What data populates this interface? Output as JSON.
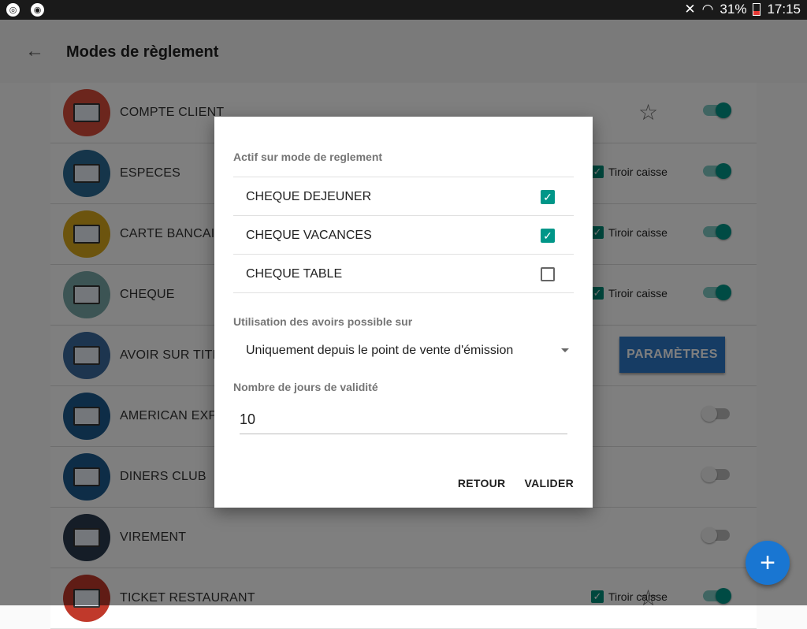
{
  "statusbar": {
    "battery": "31%",
    "time": "17:15"
  },
  "header": {
    "title": "Modes de règlement"
  },
  "payment_modes": [
    {
      "name": "COMPTE CLIENT",
      "avatar_color": "#d84c3b",
      "star": true,
      "drawer": false,
      "switch_on": true,
      "parameters_button": false
    },
    {
      "name": "ESPECES",
      "avatar_color": "#2a6a94",
      "star": false,
      "drawer": true,
      "switch_on": true,
      "parameters_button": false
    },
    {
      "name": "CARTE BANCAIRE",
      "avatar_color": "#d9a91c",
      "star": false,
      "drawer": true,
      "switch_on": true,
      "parameters_button": false
    },
    {
      "name": "CHEQUE",
      "avatar_color": "#79a9a9",
      "star": false,
      "drawer": true,
      "switch_on": true,
      "parameters_button": false
    },
    {
      "name": "AVOIR SUR TITRE",
      "avatar_color": "#3b6b9e",
      "star": false,
      "drawer": false,
      "switch_on": null,
      "parameters_button": true
    },
    {
      "name": "AMERICAN EXPRESS",
      "avatar_color": "#1d5b8f",
      "star": false,
      "drawer": false,
      "switch_on": false,
      "parameters_button": false
    },
    {
      "name": "DINERS CLUB",
      "avatar_color": "#1d5b8f",
      "star": false,
      "drawer": false,
      "switch_on": false,
      "parameters_button": false
    },
    {
      "name": "VIREMENT",
      "avatar_color": "#2b3a4f",
      "star": false,
      "drawer": false,
      "switch_on": false,
      "parameters_button": false
    },
    {
      "name": "TICKET RESTAURANT",
      "avatar_color": "#c0392b",
      "star": true,
      "drawer": true,
      "switch_on": true,
      "parameters_button": false
    }
  ],
  "row_labels": {
    "drawer": "Tiroir caisse",
    "parameters": "PARAMÈTRES"
  },
  "dialog": {
    "section_active": "Actif sur mode de reglement",
    "options": [
      {
        "label": "CHEQUE DEJEUNER",
        "checked": true
      },
      {
        "label": "CHEQUE VACANCES",
        "checked": true
      },
      {
        "label": "CHEQUE TABLE",
        "checked": false
      }
    ],
    "section_usage": "Utilisation des avoirs possible sur",
    "usage_value": "Uniquement depuis le point de vente d'émission",
    "section_validity": "Nombre de jours de validité",
    "validity_value": "10",
    "back_label": "RETOUR",
    "validate_label": "VALIDER"
  },
  "colors": {
    "accent": "#009688",
    "primary": "#1976d2",
    "parameters_button": "#2c78c8"
  },
  "icons": {
    "back": "arrow-left-icon",
    "star": "star-outline-icon",
    "fab": "plus-icon"
  }
}
